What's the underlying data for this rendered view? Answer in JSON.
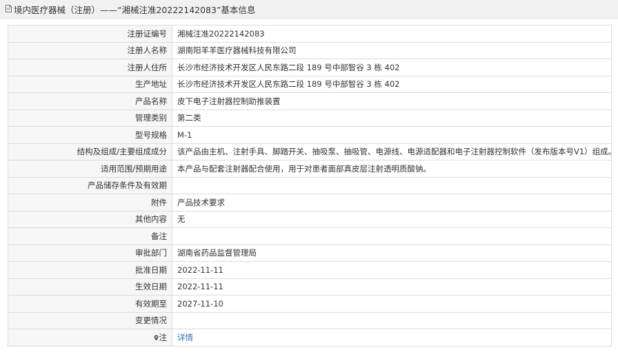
{
  "header": {
    "title": "境内医疗器械（注册）——“湘械注准20222142083”基本信息"
  },
  "rows": [
    {
      "label": "注册证编号",
      "value": "湘械注准20222142083"
    },
    {
      "label": "注册人名称",
      "value": "湖南阳羊羊医疗器械科技有限公司"
    },
    {
      "label": "注册人住所",
      "value": "长沙市经济技术开发区人民东路二段 189 号中部智谷 3 栋 402"
    },
    {
      "label": "生产地址",
      "value": "长沙市经济技术开发区人民东路二段 189 号中部智谷 3 栋 402"
    },
    {
      "label": "产品名称",
      "value": "皮下电子注射器控制助推装置"
    },
    {
      "label": "管理类别",
      "value": "第二类"
    },
    {
      "label": "型号规格",
      "value": "M-1"
    },
    {
      "label": "结构及组成/主要组成成分",
      "value": "该产品由主机、注射手具、脚踏开关、抽吸泵、抽吸管、电源线、电源适配器和电子注射器控制软件（发布版本号V1）组成。"
    },
    {
      "label": "适用范围/预期用途",
      "value": "本产品与配套注射器配合使用，用于对患者面部真皮层注射透明质酸钠。"
    },
    {
      "label": "产品储存条件及有效期",
      "value": ""
    },
    {
      "label": "附件",
      "value": "产品技术要求"
    },
    {
      "label": "其他内容",
      "value": "无"
    },
    {
      "label": "备注",
      "value": ""
    },
    {
      "label": "审批部门",
      "value": "湖南省药品监督管理局"
    },
    {
      "label": "批准日期",
      "value": "2022-11-11"
    },
    {
      "label": "生效日期",
      "value": "2022-11-11"
    },
    {
      "label": "有效期至",
      "value": "2027-11-10"
    },
    {
      "label": "变更情况",
      "value": ""
    }
  ],
  "note_row": {
    "label": "注",
    "link": "详情",
    "icon": "pin-icon"
  },
  "colors": {
    "label_bg": "#f6f6f6",
    "border": "#dcdcdc",
    "link": "#2a6ebb",
    "header_bg": "#f1f1f1"
  }
}
